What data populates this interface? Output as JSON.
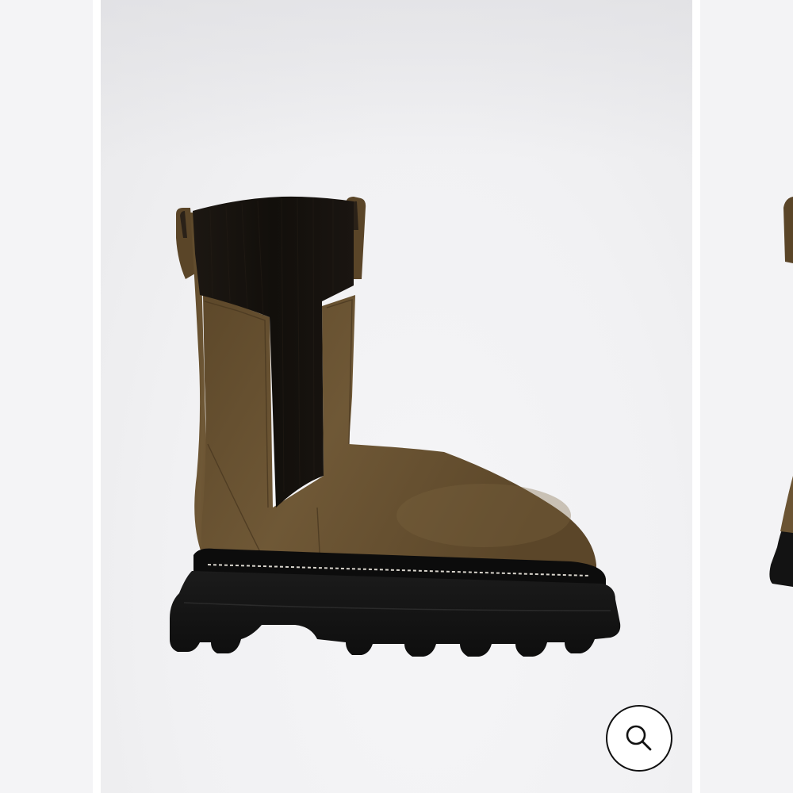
{
  "gallery": {
    "current_slide": {
      "image_name": "product-boot-image",
      "alt": ""
    },
    "zoom_button": {
      "icon": "magnifier-icon"
    }
  },
  "colors": {
    "suede": "#6b5433",
    "elastic": "#16120e",
    "sole": "#131313",
    "background": "#f2f2f4",
    "icon_stroke": "#111111"
  }
}
